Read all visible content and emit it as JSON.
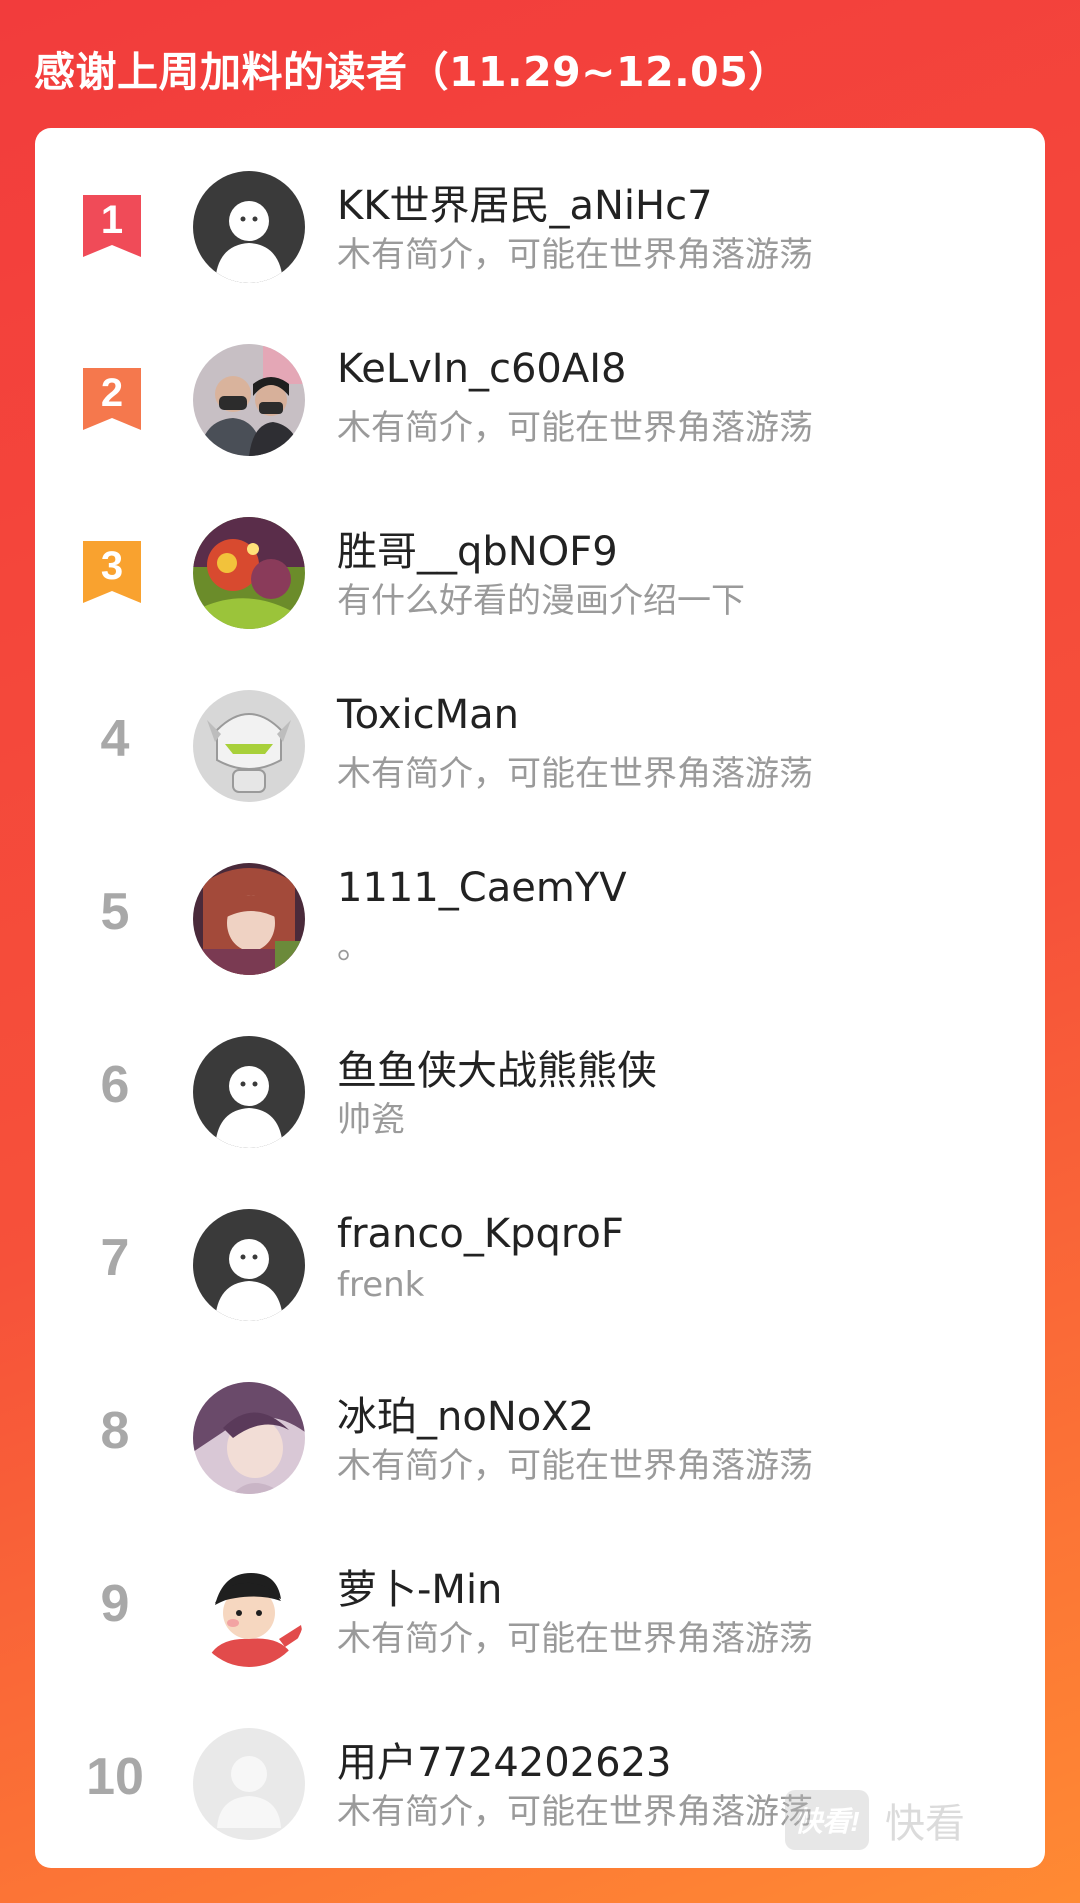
{
  "header": {
    "title": "感谢上周加料的读者（11.29~12.05）"
  },
  "rows": [
    {
      "rank": "1",
      "name": "KK世界居民_aNiHc7",
      "bio": "木有简介，可能在世界角落游荡",
      "avatar_icon": "default-avatar-icon"
    },
    {
      "rank": "2",
      "name": "KeLvIn_c60AI8",
      "bio": "木有简介，可能在世界角落游荡",
      "avatar_icon": "user-photo-avatar-icon"
    },
    {
      "rank": "3",
      "name": "胜哥__qbNOF9",
      "bio": "有什么好看的漫画介绍一下",
      "avatar_icon": "colorful-art-avatar-icon"
    },
    {
      "rank": "4",
      "name": "ToxicMan",
      "bio": "木有简介，可能在世界角落游荡",
      "avatar_icon": "robot-helmet-avatar-icon"
    },
    {
      "rank": "5",
      "name": "1111_CaemYV",
      "bio": "。",
      "avatar_icon": "anime-girl-avatar-icon"
    },
    {
      "rank": "6",
      "name": "鱼鱼侠大战熊熊侠",
      "bio": "帅瓷",
      "avatar_icon": "default-avatar-icon"
    },
    {
      "rank": "7",
      "name": "franco_KpqroF",
      "bio": "frenk",
      "avatar_icon": "default-avatar-icon"
    },
    {
      "rank": "8",
      "name": "冰珀_noNoX2",
      "bio": "木有简介，可能在世界角落游荡",
      "avatar_icon": "anime-boy-avatar-icon"
    },
    {
      "rank": "9",
      "name": "萝卜-Min",
      "bio": "木有简介，可能在世界角落游荡",
      "avatar_icon": "cartoon-boy-avatar-icon"
    },
    {
      "rank": "10",
      "name": "用户7724202623",
      "bio": "木有简介，可能在世界角落游荡",
      "avatar_icon": "blank-avatar-icon"
    }
  ],
  "badge_colors": {
    "1": "#f04b58",
    "2": "#f5784d",
    "3": "#f9a22f"
  },
  "watermark": {
    "logo": "快看!",
    "text": "快看"
  }
}
